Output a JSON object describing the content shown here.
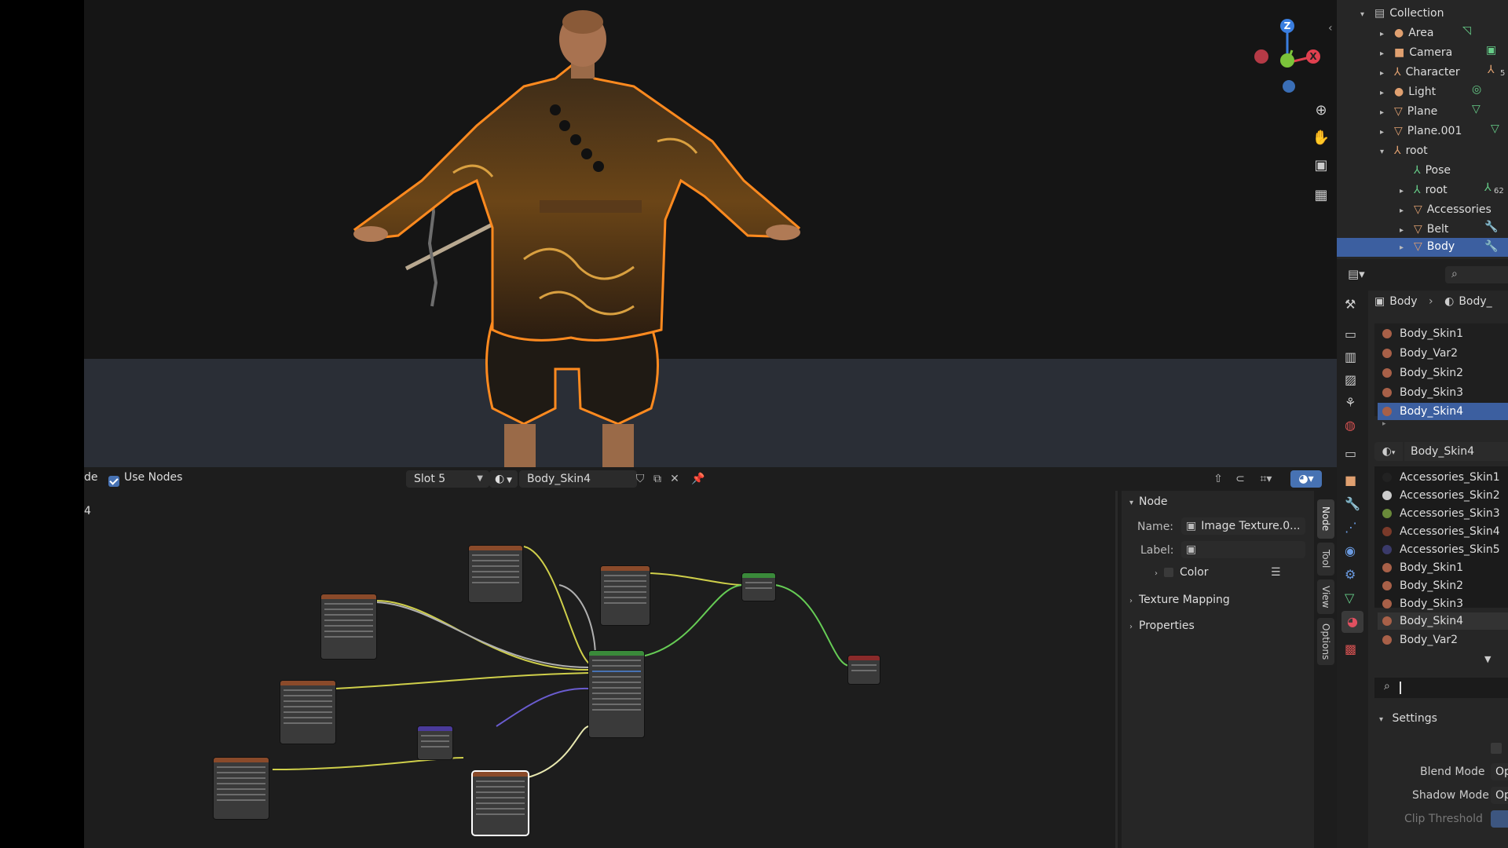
{
  "node_editor": {
    "mode_fragment": "de",
    "use_nodes_label": "Use Nodes",
    "slot": "Slot 5",
    "material_name": "Body_Skin4",
    "left_number": "4"
  },
  "n_panel": {
    "node_header": "Node",
    "name_label": "Name:",
    "name_value": "Image Texture.0...",
    "label_label": "Label:",
    "color_label": "Color",
    "texture_mapping": "Texture Mapping",
    "properties": "Properties",
    "tabs": [
      "Node",
      "Tool",
      "View",
      "Options"
    ]
  },
  "outliner": {
    "items": [
      {
        "label": "Collection"
      },
      {
        "label": "Area"
      },
      {
        "label": "Camera"
      },
      {
        "label": "Character"
      },
      {
        "label": "Light"
      },
      {
        "label": "Plane"
      },
      {
        "label": "Plane.001"
      },
      {
        "label": "root"
      },
      {
        "label": "Pose"
      },
      {
        "label": "root",
        "badge": "62"
      },
      {
        "label": "Accessories"
      },
      {
        "label": "Belt"
      },
      {
        "label": "Body"
      }
    ],
    "character_badge": "5"
  },
  "properties": {
    "breadcrumb_object": "Body",
    "breadcrumb_material": "Body_",
    "slots": [
      "Body_Skin1",
      "Body_Var2",
      "Body_Skin2",
      "Body_Skin3",
      "Body_Skin4"
    ],
    "active_material": "Body_Skin4",
    "dropdown_materials": [
      "Accessories_Skin1",
      "Accessories_Skin2",
      "Accessories_Skin3",
      "Accessories_Skin4",
      "Accessories_Skin5",
      "Body_Skin1",
      "Body_Skin2",
      "Body_Skin3",
      "Body_Skin4",
      "Body_Var2"
    ],
    "settings_header": "Settings",
    "blend_mode_label": "Blend Mode",
    "blend_mode_value": "Op",
    "shadow_mode_label": "Shadow Mode",
    "shadow_mode_value": "Op",
    "clip_threshold_label": "Clip Threshold"
  },
  "gizmo": {
    "z": "Z",
    "x": "X"
  },
  "colors": {
    "accent_blue": "#4772b3",
    "selection_blue": "#3c5fa0",
    "outline_orange": "#ff8a1f",
    "axis_x": "#e0404f",
    "axis_y": "#7bc33a",
    "axis_z": "#3a7ee0"
  }
}
